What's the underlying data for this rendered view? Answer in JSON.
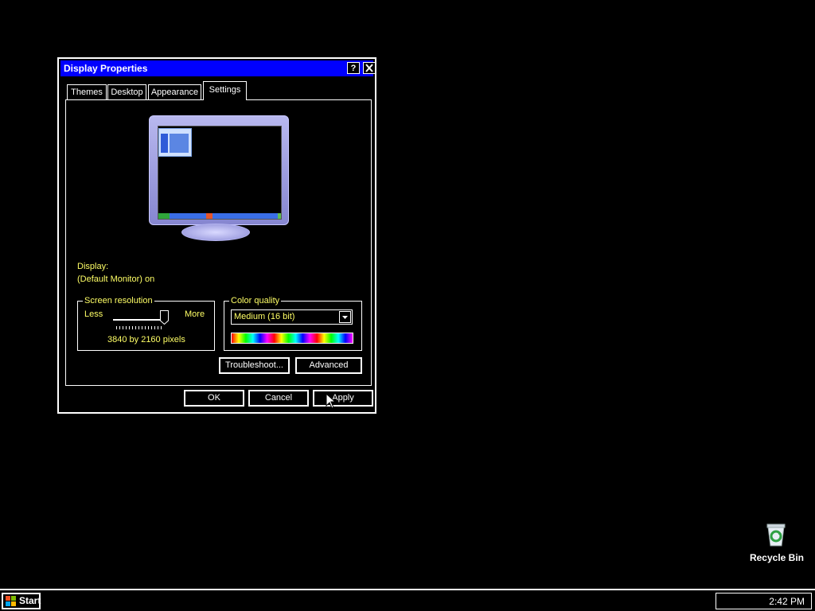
{
  "window": {
    "title": "Display Properties",
    "help_label": "?",
    "close_label": "✕"
  },
  "tabs": [
    {
      "label": "Themes"
    },
    {
      "label": "Desktop"
    },
    {
      "label": "Appearance"
    },
    {
      "label": "Settings"
    }
  ],
  "active_tab": "Settings",
  "display": {
    "label": "Display:",
    "value": "(Default Monitor) on"
  },
  "screen_resolution": {
    "legend": "Screen resolution",
    "less_label": "Less",
    "more_label": "More",
    "value_text": "3840 by 2160 pixels",
    "slider_level": 1.0
  },
  "color_quality": {
    "legend": "Color quality",
    "selected": "Medium (16 bit)"
  },
  "buttons": {
    "troubleshoot": "Troubleshoot...",
    "advanced": "Advanced",
    "ok": "OK",
    "cancel": "Cancel",
    "apply": "Apply"
  },
  "desktop": {
    "recycle_bin_label": "Recycle Bin"
  },
  "taskbar": {
    "start_label": "Start",
    "clock": "2:42 PM"
  },
  "colors": {
    "title_bar": "#0000ff",
    "label_text": "#ffff66",
    "background": "#000000"
  }
}
